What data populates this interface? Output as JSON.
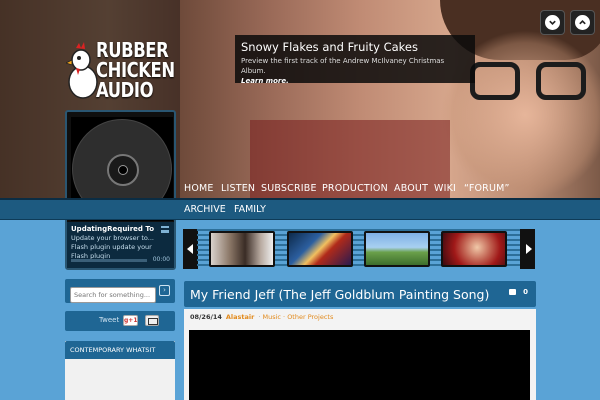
{
  "logo": {
    "line1": "RUBBER",
    "line2": "CHICKEN",
    "line3": "AUDIO"
  },
  "feature": {
    "title": "Snowy Flakes and Fruity Cakes",
    "desc": "Preview the first track of the Andrew McIlvaney Christmas Album.",
    "link": "Learn more."
  },
  "player": {
    "title_line": "UpdatingRequired To",
    "body": "Update your browser to... Flash plugin update your Flash plugin",
    "time": "00:00"
  },
  "nav": {
    "items": [
      "HOME",
      "LISTEN",
      "SUBSCRIBE",
      "PRODUCTION",
      "ABOUT",
      "WIKI",
      "“FORUM”"
    ],
    "sub_items": [
      "ARCHIVE",
      "FAMILY"
    ]
  },
  "search": {
    "placeholder": "Search for something..."
  },
  "social": {
    "tweet": "Tweet",
    "gplus": "g+1"
  },
  "whatsit": {
    "title": "CONTEMPORARY WHATSIT"
  },
  "post": {
    "title": "My Friend Jeff (The Jeff Goldblum Painting Song)",
    "comments": "0",
    "date": "08/26/14",
    "author": "Alastair",
    "categories": "Music · Other Projects"
  },
  "colors": {
    "accent": "#1f6694",
    "dark_bar": "#1d5a80",
    "page_bg": "#5aa3d6",
    "meta_orange": "#e28a1c"
  },
  "icons": [
    "chevron-down-icon",
    "chevron-up-icon",
    "vinyl-record-icon",
    "playlist-icon",
    "search-arrow-icon",
    "comment-icon",
    "email-icon",
    "arrow-left-icon",
    "arrow-right-icon"
  ]
}
